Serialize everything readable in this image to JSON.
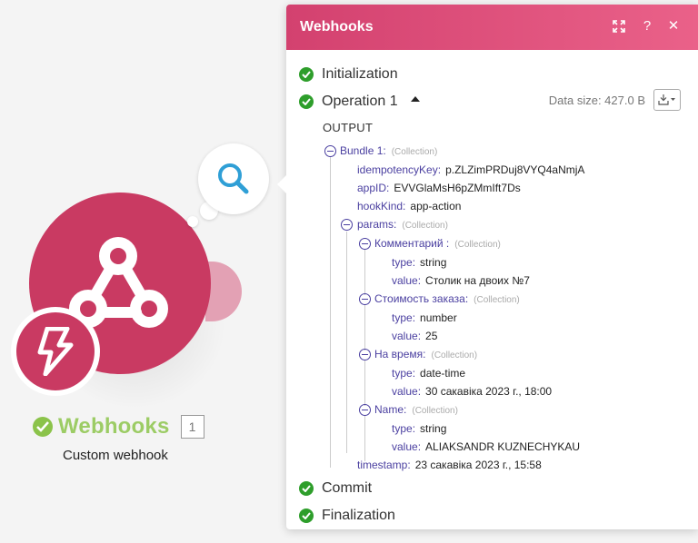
{
  "canvas": {
    "module_title": "Webhooks",
    "module_count": "1",
    "module_subtitle": "Custom webhook"
  },
  "panel": {
    "title": "Webhooks",
    "help_label": "?",
    "close_label": "✕",
    "initialization": "Initialization",
    "operation": "Operation 1",
    "data_size": "Data size: 427.0 B",
    "output_label": "OUTPUT",
    "commit": "Commit",
    "finalization": "Finalization",
    "collection_tag": "(Collection)",
    "bundle": {
      "label": "Bundle 1",
      "idempotencyKey": "p.ZLZimPRDuj8VYQ4aNmjA",
      "appID": "EVVGlaMsH6pZMmIft7Ds",
      "hookKind": "app-action",
      "params_label": "params",
      "comment_label": "Комментарий ",
      "comment_type": "string",
      "comment_value": "Столик на двоих №7",
      "cost_label": "Стоимость заказа",
      "cost_type": "number",
      "cost_value": "25",
      "time_label": "На время",
      "time_type": "date-time",
      "time_value": "30 сакавіка 2023 г., 18:00",
      "name_label": "Name",
      "name_type": "string",
      "name_value": "ALIAKSANDR KUZNECHYKAU",
      "timestamp": "23 сакавіка 2023 г., 15:58"
    },
    "keys": {
      "idempotencyKey": "idempotencyKey",
      "appID": "appID",
      "hookKind": "hookKind",
      "type": "type",
      "value": "value",
      "timestamp": "timestamp"
    }
  },
  "colors": {
    "brand": "#c93a62",
    "header_start": "#d3416f",
    "header_end": "#ea6189",
    "success": "#2e9e2b",
    "module_title": "#9ccc65",
    "tree_key": "#4a3fa0"
  }
}
